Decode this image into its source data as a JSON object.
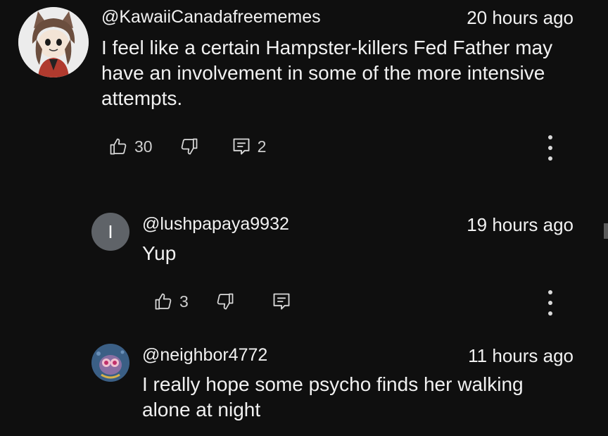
{
  "comments": [
    {
      "username": "@KawaiiCanadafreememes",
      "timestamp": "20 hours ago",
      "text": "I feel like a certain Hampster-killers Fed Father may have an involvement in some of the more intensive attempts.",
      "likes": "30",
      "replies": "2",
      "avatar_icon": "cartoon-cat-girl-avatar"
    },
    {
      "username": "@lushpapaya9932",
      "timestamp": "19 hours ago",
      "text": "Yup",
      "likes": "3",
      "avatar_letter": "I",
      "avatar_color": "#5f6368"
    },
    {
      "username": "@neighbor4772",
      "timestamp": "11 hours ago",
      "text": "I really hope some psycho finds her walking alone at night",
      "avatar_icon": "cartoon-creature-avatar"
    }
  ],
  "colors": {
    "background": "#0f0f0f",
    "text": "#f1f1f1"
  }
}
